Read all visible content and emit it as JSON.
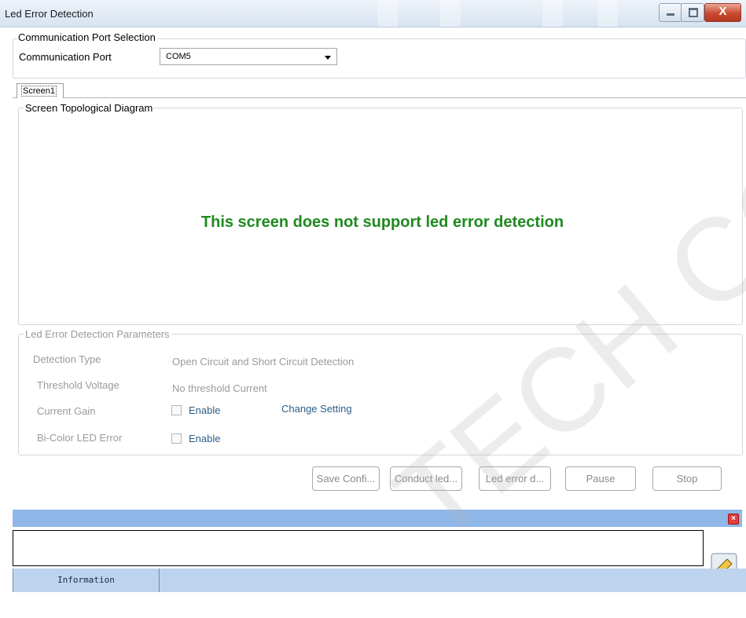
{
  "window": {
    "title": "Led Error Detection",
    "close_symbol": "X"
  },
  "port_section": {
    "legend": "Communication Port Selection",
    "label": "Communication Port",
    "selected_port": "COM5"
  },
  "tabs": [
    {
      "label": "Screen1",
      "selected": true
    }
  ],
  "diagram": {
    "legend": "Screen Topological Diagram",
    "message": "This screen does not support led error detection",
    "message_color": "#1f8a1f"
  },
  "params": {
    "legend": "Led Error Detection Parameters",
    "detection_type_label": "Detection Type",
    "detection_type_value": "Open Circuit and Short Circuit Detection",
    "threshold_label": "Threshold Voltage",
    "threshold_value": "No threshold Current",
    "current_gain_label": "Current Gain",
    "current_gain_enable": "Enable",
    "change_setting": "Change Setting",
    "bicolor_label": "Bi-Color LED Error",
    "bicolor_enable": "Enable"
  },
  "buttons": {
    "save": "Save Confi...",
    "conduct": "Conduct led...",
    "error": "Led error d...",
    "pause": "Pause",
    "stop": "Stop"
  },
  "status": {
    "info_tab": "Information"
  },
  "watermark": "TECH CO., LT",
  "colors": {
    "accent_blue": "#8fb7e8",
    "status_blue": "#bdd3ee",
    "close_red": "#c9492f"
  }
}
